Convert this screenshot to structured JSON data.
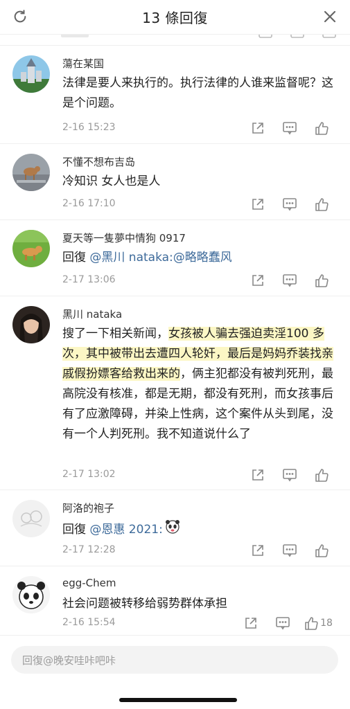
{
  "header": {
    "title": "13 條回復",
    "refresh_icon": "refresh-icon",
    "close_icon": "close-icon"
  },
  "comments": [
    {
      "user": "蕩在某国",
      "text": "法律是要人来执行的。执行法律的人谁来监督呢？这是个问题。",
      "time": "2-16 15:23",
      "likes": ""
    },
    {
      "user": "不懂不想布吉岛",
      "text": "冷知识 女人也是人",
      "time": "2-16 17:10",
      "likes": ""
    },
    {
      "user": "夏天等一隻夢中情狗 0917",
      "reply_prefix": "回復",
      "mention": "@黑川 nataka:@略略蠢风",
      "time": "2-17 13:06",
      "likes": ""
    },
    {
      "user": "黑川 nataka",
      "text_before": "搜了一下相关新闻，",
      "text_highlight": "女孩被人骗去强迫卖淫100 多次，其中被带出去遭四人轮奸，最后是妈妈乔装找亲戚假扮嫖客给救出来的",
      "text_after": "，俩主犯都没有被判死刑，最高院没有核准，都是无期，都没有死刑，而女孩事后有了应激障碍，并染上性病，这个案件从头到尾，没有一个人判死刑。我不知道说什么了",
      "time": "2-17 13:02",
      "likes": ""
    },
    {
      "user": "阿洛的袍子",
      "reply_prefix": "回復",
      "mention": "@恩惠 2021:",
      "time": "2-17 12:28",
      "likes": ""
    },
    {
      "user": "egg-Chem",
      "text": "社会问题被转移给弱势群体承担",
      "time": "2-16 15:54",
      "likes": "18"
    }
  ],
  "reply_bar": {
    "placeholder": "回復@晚安哇咔吧咔"
  },
  "colors": {
    "mention": "#3d6a9a",
    "highlight": "#faf096",
    "meta": "#9a9a9a"
  }
}
